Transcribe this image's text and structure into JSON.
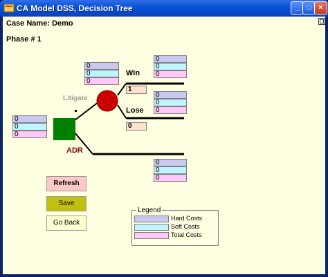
{
  "window": {
    "title": "CA Model DSS, Decision Tree",
    "controls": [
      "_",
      "□",
      "×"
    ]
  },
  "header": {
    "case_name": "Case Name: Demo",
    "phase": "Phase # 1"
  },
  "tree": {
    "litigate_label": "Litigate",
    "adr_label": "ADR",
    "win_label": "Win",
    "lose_label": "Lose",
    "win_probability": "1",
    "lose_probability": "0",
    "adr_node_color": "#008000",
    "litigate_node_color": "#cc0000",
    "litigate_costs": {
      "hard": "0",
      "soft": "0",
      "total": "0"
    },
    "adr_costs": {
      "hard": "0",
      "soft": "0",
      "total": "0"
    },
    "win_costs": {
      "hard": "0",
      "soft": "0",
      "total": "0"
    },
    "lose_costs": {
      "hard": "0",
      "soft": "0",
      "total": "0"
    },
    "adr_outcome_costs": {
      "hard": "0",
      "soft": "0",
      "total": "0"
    }
  },
  "buttons": {
    "refresh": "Refresh",
    "save": "Save",
    "go_back": "Go Back"
  },
  "legend": {
    "title": "Legend",
    "items": [
      "Hard Costs",
      "Soft Costs",
      "Total Costs"
    ],
    "colors": [
      "#c8c8f0",
      "#c0f4ff",
      "#ffc8f8"
    ]
  }
}
